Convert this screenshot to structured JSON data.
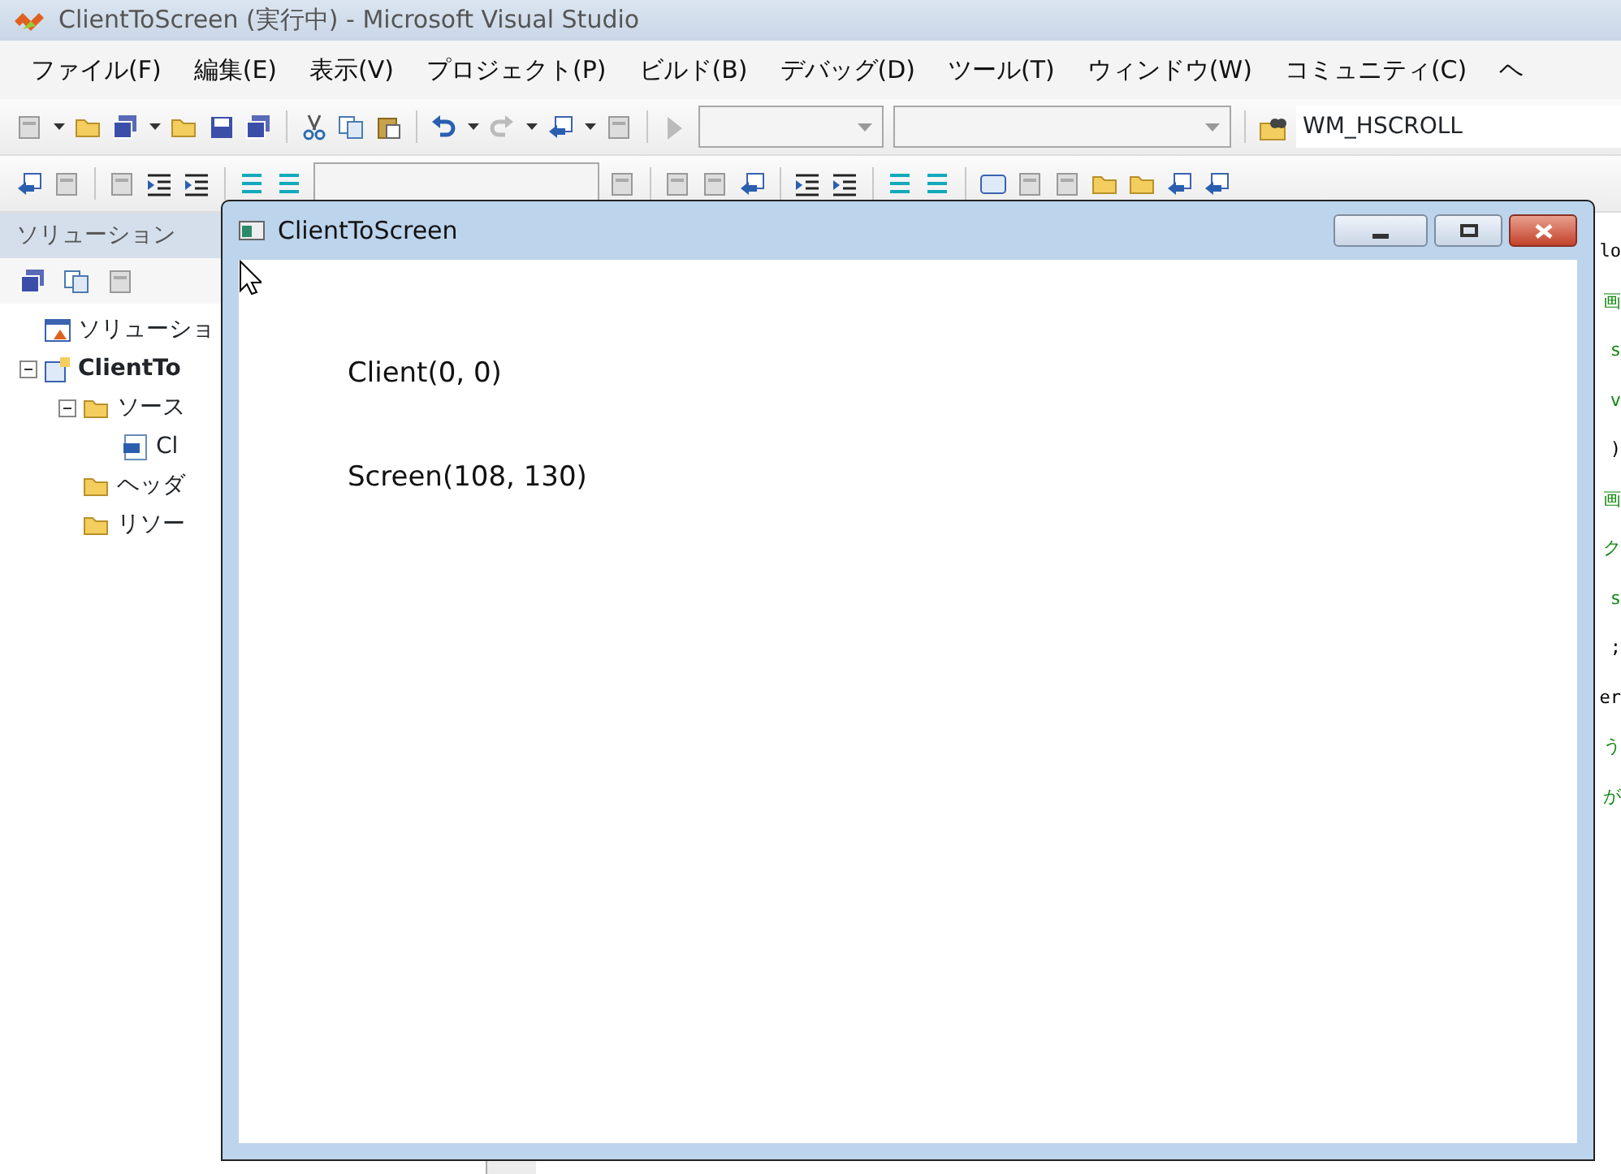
{
  "window": {
    "title": "ClientToScreen (実行中) - Microsoft Visual Studio"
  },
  "menu": [
    "ファイル(F)",
    "編集(E)",
    "表示(V)",
    "プロジェクト(P)",
    "ビルド(B)",
    "デバッグ(D)",
    "ツール(T)",
    "ウィンドウ(W)",
    "コミュニティ(C)",
    "ヘ"
  ],
  "toolbar": {
    "find_text": "WM_HSCROLL"
  },
  "solution_explorer": {
    "title": "ソリューション",
    "tree": [
      {
        "label": "ソリューショ",
        "kind": "solution"
      },
      {
        "label": "ClientTo",
        "kind": "project",
        "expanded": true,
        "children": [
          {
            "label": "ソース",
            "kind": "folder",
            "expanded": true,
            "children": [
              {
                "label": "Cl",
                "kind": "cpp"
              }
            ]
          },
          {
            "label": "ヘッダ",
            "kind": "folder"
          },
          {
            "label": "リソー",
            "kind": "folder"
          }
        ]
      }
    ]
  },
  "code_fragments": [
    {
      "text": "lo",
      "kind": "code"
    },
    {
      "text": "画",
      "kind": "comment"
    },
    {
      "text": "s",
      "kind": "comment"
    },
    {
      "text": "v",
      "kind": "comment"
    },
    {
      "text": ")",
      "kind": "code"
    },
    {
      "text": "画",
      "kind": "comment"
    },
    {
      "text": "ク",
      "kind": "comment"
    },
    {
      "text": "s",
      "kind": "comment"
    },
    {
      "text": ";",
      "kind": "code"
    },
    {
      "text": "er",
      "kind": "code"
    },
    {
      "text": "う",
      "kind": "comment"
    },
    {
      "text": "が",
      "kind": "comment"
    }
  ],
  "app_window": {
    "title": "ClientToScreen",
    "lines": [
      "Client(0, 0)",
      "Screen(108, 130)"
    ]
  }
}
